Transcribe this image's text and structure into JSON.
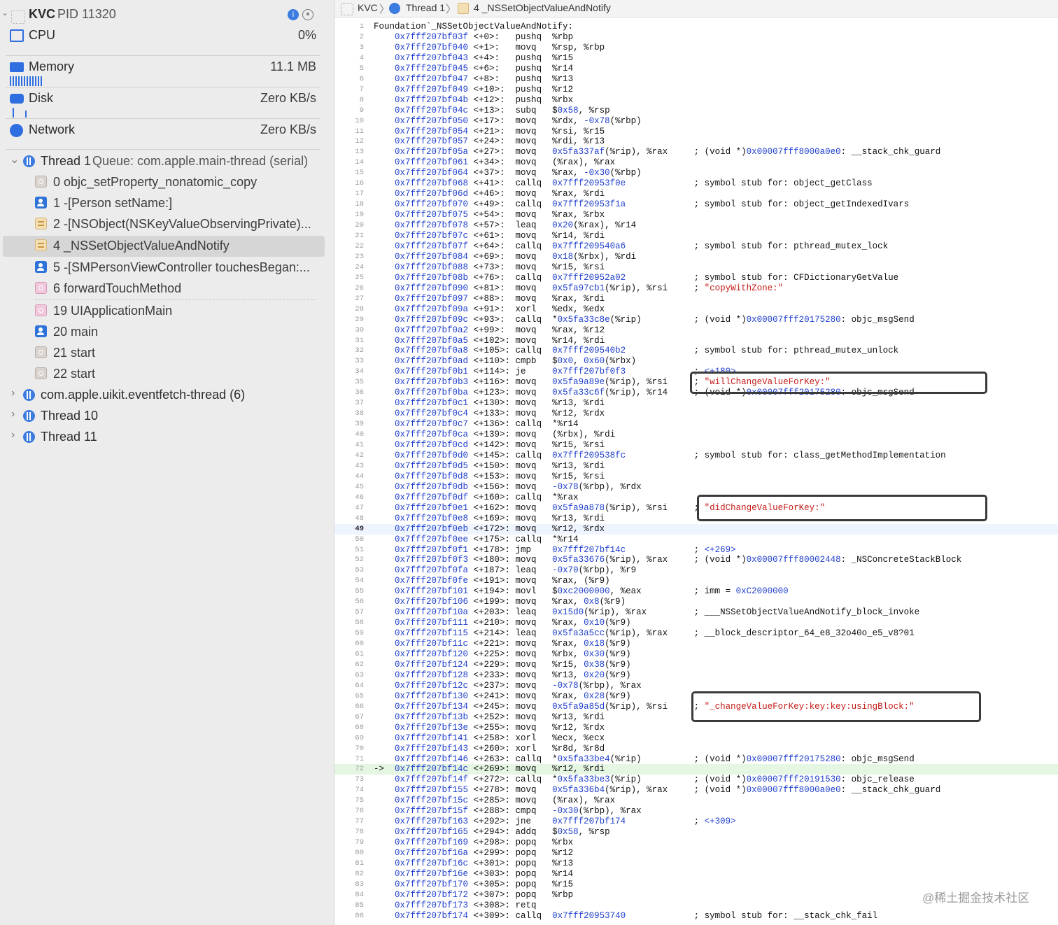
{
  "sidebar": {
    "process": {
      "name": "KVC",
      "pid": "PID 11320"
    },
    "gauges": [
      {
        "label": "CPU",
        "value": "0%"
      },
      {
        "label": "Memory",
        "value": "11.1 MB"
      },
      {
        "label": "Disk",
        "value": "Zero KB/s"
      },
      {
        "label": "Network",
        "value": "Zero KB/s"
      }
    ],
    "thread1": {
      "title": "Thread 1",
      "queue": "Queue: com.apple.main-thread (serial)"
    },
    "frames": [
      {
        "label": "0 objc_setProperty_nonatomic_copy",
        "kind": "sys"
      },
      {
        "label": "1 -[Person setName:]",
        "kind": "user"
      },
      {
        "label": "2 -[NSObject(NSKeyValueObservingPrivate)...",
        "kind": "fw"
      },
      {
        "label": "4 _NSSetObjectValueAndNotify",
        "kind": "fw",
        "selected": true
      },
      {
        "label": "5 -[SMPersonViewController touchesBegan:...",
        "kind": "user"
      },
      {
        "label": "6 forwardTouchMethod",
        "kind": "pink"
      },
      {
        "label": "19 UIApplicationMain",
        "kind": "pink"
      },
      {
        "label": "20 main",
        "kind": "user"
      },
      {
        "label": "21 start",
        "kind": "sys"
      },
      {
        "label": "22 start",
        "kind": "sys"
      }
    ],
    "other_threads": [
      "com.apple.uikit.eventfetch-thread (6)",
      "Thread 10",
      "Thread 11"
    ]
  },
  "breadcrumb": [
    "KVC",
    "Thread 1",
    "4 _NSSetObjectValueAndNotify"
  ],
  "disassembly": {
    "header": "Foundation`_NSSetObjectValueAndNotify:",
    "current_line": 49,
    "pc_line": 72,
    "pc_arrow": "->",
    "lines": [
      [
        "0x7fff207bf03f",
        "<+0>:",
        "pushq",
        "%rbp",
        ""
      ],
      [
        "0x7fff207bf040",
        "<+1>:",
        "movq",
        "%rsp, %rbp",
        ""
      ],
      [
        "0x7fff207bf043",
        "<+4>:",
        "pushq",
        "%r15",
        ""
      ],
      [
        "0x7fff207bf045",
        "<+6>:",
        "pushq",
        "%r14",
        ""
      ],
      [
        "0x7fff207bf047",
        "<+8>:",
        "pushq",
        "%r13",
        ""
      ],
      [
        "0x7fff207bf049",
        "<+10>:",
        "pushq",
        "%r12",
        ""
      ],
      [
        "0x7fff207bf04b",
        "<+12>:",
        "pushq",
        "%rbx",
        ""
      ],
      [
        "0x7fff207bf04c",
        "<+13>:",
        "subq",
        "$0x58, %rsp",
        ""
      ],
      [
        "0x7fff207bf050",
        "<+17>:",
        "movq",
        "%rdx, -0x78(%rbp)",
        ""
      ],
      [
        "0x7fff207bf054",
        "<+21>:",
        "movq",
        "%rsi, %r15",
        ""
      ],
      [
        "0x7fff207bf057",
        "<+24>:",
        "movq",
        "%rdi, %r13",
        ""
      ],
      [
        "0x7fff207bf05a",
        "<+27>:",
        "movq",
        "0x5fa337af(%rip), %rax",
        "; (void *)0x00007fff8000a0e0: __stack_chk_guard"
      ],
      [
        "0x7fff207bf061",
        "<+34>:",
        "movq",
        "(%rax), %rax",
        ""
      ],
      [
        "0x7fff207bf064",
        "<+37>:",
        "movq",
        "%rax, -0x30(%rbp)",
        ""
      ],
      [
        "0x7fff207bf068",
        "<+41>:",
        "callq",
        "0x7fff20953f0e",
        "; symbol stub for: object_getClass"
      ],
      [
        "0x7fff207bf06d",
        "<+46>:",
        "movq",
        "%rax, %rdi",
        ""
      ],
      [
        "0x7fff207bf070",
        "<+49>:",
        "callq",
        "0x7fff20953f1a",
        "; symbol stub for: object_getIndexedIvars"
      ],
      [
        "0x7fff207bf075",
        "<+54>:",
        "movq",
        "%rax, %rbx",
        ""
      ],
      [
        "0x7fff207bf078",
        "<+57>:",
        "leaq",
        "0x20(%rax), %r14",
        ""
      ],
      [
        "0x7fff207bf07c",
        "<+61>:",
        "movq",
        "%r14, %rdi",
        ""
      ],
      [
        "0x7fff207bf07f",
        "<+64>:",
        "callq",
        "0x7fff209540a6",
        "; symbol stub for: pthread_mutex_lock"
      ],
      [
        "0x7fff207bf084",
        "<+69>:",
        "movq",
        "0x18(%rbx), %rdi",
        ""
      ],
      [
        "0x7fff207bf088",
        "<+73>:",
        "movq",
        "%r15, %rsi",
        ""
      ],
      [
        "0x7fff207bf08b",
        "<+76>:",
        "callq",
        "0x7fff20952a02",
        "; symbol stub for: CFDictionaryGetValue"
      ],
      [
        "0x7fff207bf090",
        "<+81>:",
        "movq",
        "0x5fa97cb1(%rip), %rsi",
        "; \"copyWithZone:\""
      ],
      [
        "0x7fff207bf097",
        "<+88>:",
        "movq",
        "%rax, %rdi",
        ""
      ],
      [
        "0x7fff207bf09a",
        "<+91>:",
        "xorl",
        "%edx, %edx",
        ""
      ],
      [
        "0x7fff207bf09c",
        "<+93>:",
        "callq",
        "*0x5fa33c8e(%rip)",
        "; (void *)0x00007fff20175280: objc_msgSend"
      ],
      [
        "0x7fff207bf0a2",
        "<+99>:",
        "movq",
        "%rax, %r12",
        ""
      ],
      [
        "0x7fff207bf0a5",
        "<+102>:",
        "movq",
        "%r14, %rdi",
        ""
      ],
      [
        "0x7fff207bf0a8",
        "<+105>:",
        "callq",
        "0x7fff209540b2",
        "; symbol stub for: pthread_mutex_unlock"
      ],
      [
        "0x7fff207bf0ad",
        "<+110>:",
        "cmpb",
        "$0x0, 0x60(%rbx)",
        ""
      ],
      [
        "0x7fff207bf0b1",
        "<+114>:",
        "je",
        "0x7fff207bf0f3",
        "; <+180>"
      ],
      [
        "0x7fff207bf0b3",
        "<+116>:",
        "movq",
        "0x5fa9a89e(%rip), %rsi",
        "; \"willChangeValueForKey:\""
      ],
      [
        "0x7fff207bf0ba",
        "<+123>:",
        "movq",
        "0x5fa33c6f(%rip), %r14",
        "; (void *)0x00007fff20175280: objc_msgSend"
      ],
      [
        "0x7fff207bf0c1",
        "<+130>:",
        "movq",
        "%r13, %rdi",
        ""
      ],
      [
        "0x7fff207bf0c4",
        "<+133>:",
        "movq",
        "%r12, %rdx",
        ""
      ],
      [
        "0x7fff207bf0c7",
        "<+136>:",
        "callq",
        "*%r14",
        ""
      ],
      [
        "0x7fff207bf0ca",
        "<+139>:",
        "movq",
        "(%rbx), %rdi",
        ""
      ],
      [
        "0x7fff207bf0cd",
        "<+142>:",
        "movq",
        "%r15, %rsi",
        ""
      ],
      [
        "0x7fff207bf0d0",
        "<+145>:",
        "callq",
        "0x7fff209538fc",
        "; symbol stub for: class_getMethodImplementation"
      ],
      [
        "0x7fff207bf0d5",
        "<+150>:",
        "movq",
        "%r13, %rdi",
        ""
      ],
      [
        "0x7fff207bf0d8",
        "<+153>:",
        "movq",
        "%r15, %rsi",
        ""
      ],
      [
        "0x7fff207bf0db",
        "<+156>:",
        "movq",
        "-0x78(%rbp), %rdx",
        ""
      ],
      [
        "0x7fff207bf0df",
        "<+160>:",
        "callq",
        "*%rax",
        ""
      ],
      [
        "0x7fff207bf0e1",
        "<+162>:",
        "movq",
        "0x5fa9a878(%rip), %rsi",
        "; \"didChangeValueForKey:\""
      ],
      [
        "0x7fff207bf0e8",
        "<+169>:",
        "movq",
        "%r13, %rdi",
        ""
      ],
      [
        "0x7fff207bf0eb",
        "<+172>:",
        "movq",
        "%r12, %rdx",
        ""
      ],
      [
        "0x7fff207bf0ee",
        "<+175>:",
        "callq",
        "*%r14",
        ""
      ],
      [
        "0x7fff207bf0f1",
        "<+178>:",
        "jmp",
        "0x7fff207bf14c",
        "; <+269>"
      ],
      [
        "0x7fff207bf0f3",
        "<+180>:",
        "movq",
        "0x5fa33676(%rip), %rax",
        "; (void *)0x00007fff80002448: _NSConcreteStackBlock"
      ],
      [
        "0x7fff207bf0fa",
        "<+187>:",
        "leaq",
        "-0x70(%rbp), %r9",
        ""
      ],
      [
        "0x7fff207bf0fe",
        "<+191>:",
        "movq",
        "%rax, (%r9)",
        ""
      ],
      [
        "0x7fff207bf101",
        "<+194>:",
        "movl",
        "$0xc2000000, %eax",
        "; imm = 0xC2000000"
      ],
      [
        "0x7fff207bf106",
        "<+199>:",
        "movq",
        "%rax, 0x8(%r9)",
        ""
      ],
      [
        "0x7fff207bf10a",
        "<+203>:",
        "leaq",
        "0x15d0(%rip), %rax",
        "; ___NSSetObjectValueAndNotify_block_invoke"
      ],
      [
        "0x7fff207bf111",
        "<+210>:",
        "movq",
        "%rax, 0x10(%r9)",
        ""
      ],
      [
        "0x7fff207bf115",
        "<+214>:",
        "leaq",
        "0x5fa3a5cc(%rip), %rax",
        "; __block_descriptor_64_e8_32o40o_e5_v8?01"
      ],
      [
        "0x7fff207bf11c",
        "<+221>:",
        "movq",
        "%rax, 0x18(%r9)",
        ""
      ],
      [
        "0x7fff207bf120",
        "<+225>:",
        "movq",
        "%rbx, 0x30(%r9)",
        ""
      ],
      [
        "0x7fff207bf124",
        "<+229>:",
        "movq",
        "%r15, 0x38(%r9)",
        ""
      ],
      [
        "0x7fff207bf128",
        "<+233>:",
        "movq",
        "%r13, 0x20(%r9)",
        ""
      ],
      [
        "0x7fff207bf12c",
        "<+237>:",
        "movq",
        "-0x78(%rbp), %rax",
        ""
      ],
      [
        "0x7fff207bf130",
        "<+241>:",
        "movq",
        "%rax, 0x28(%r9)",
        ""
      ],
      [
        "0x7fff207bf134",
        "<+245>:",
        "movq",
        "0x5fa9a85d(%rip), %rsi",
        "; \"_changeValueForKey:key:key:usingBlock:\""
      ],
      [
        "0x7fff207bf13b",
        "<+252>:",
        "movq",
        "%r13, %rdi",
        ""
      ],
      [
        "0x7fff207bf13e",
        "<+255>:",
        "movq",
        "%r12, %rdx",
        ""
      ],
      [
        "0x7fff207bf141",
        "<+258>:",
        "xorl",
        "%ecx, %ecx",
        ""
      ],
      [
        "0x7fff207bf143",
        "<+260>:",
        "xorl",
        "%r8d, %r8d",
        ""
      ],
      [
        "0x7fff207bf146",
        "<+263>:",
        "callq",
        "*0x5fa33be4(%rip)",
        "; (void *)0x00007fff20175280: objc_msgSend"
      ],
      [
        "0x7fff207bf14c",
        "<+269>:",
        "movq",
        "%r12, %rdi",
        ""
      ],
      [
        "0x7fff207bf14f",
        "<+272>:",
        "callq",
        "*0x5fa33be3(%rip)",
        "; (void *)0x00007fff20191530: objc_release"
      ],
      [
        "0x7fff207bf155",
        "<+278>:",
        "movq",
        "0x5fa336b4(%rip), %rax",
        "; (void *)0x00007fff8000a0e0: __stack_chk_guard"
      ],
      [
        "0x7fff207bf15c",
        "<+285>:",
        "movq",
        "(%rax), %rax",
        ""
      ],
      [
        "0x7fff207bf15f",
        "<+288>:",
        "cmpq",
        "-0x30(%rbp), %rax",
        ""
      ],
      [
        "0x7fff207bf163",
        "<+292>:",
        "jne",
        "0x7fff207bf174",
        "; <+309>"
      ],
      [
        "0x7fff207bf165",
        "<+294>:",
        "addq",
        "$0x58, %rsp",
        ""
      ],
      [
        "0x7fff207bf169",
        "<+298>:",
        "popq",
        "%rbx",
        ""
      ],
      [
        "0x7fff207bf16a",
        "<+299>:",
        "popq",
        "%r12",
        ""
      ],
      [
        "0x7fff207bf16c",
        "<+301>:",
        "popq",
        "%r13",
        ""
      ],
      [
        "0x7fff207bf16e",
        "<+303>:",
        "popq",
        "%r14",
        ""
      ],
      [
        "0x7fff207bf170",
        "<+305>:",
        "popq",
        "%r15",
        ""
      ],
      [
        "0x7fff207bf172",
        "<+307>:",
        "popq",
        "%rbp",
        ""
      ],
      [
        "0x7fff207bf173",
        "<+308>:",
        "retq",
        "",
        ""
      ],
      [
        "0x7fff207bf174",
        "<+309>:",
        "callq",
        "0x7fff20953740",
        "; symbol stub for: __stack_chk_fail"
      ]
    ]
  },
  "annotations": [
    {
      "for_line": 35
    },
    {
      "for_line": 47
    },
    {
      "for_line": 66
    }
  ],
  "watermark": "@稀土掘金技术社区"
}
